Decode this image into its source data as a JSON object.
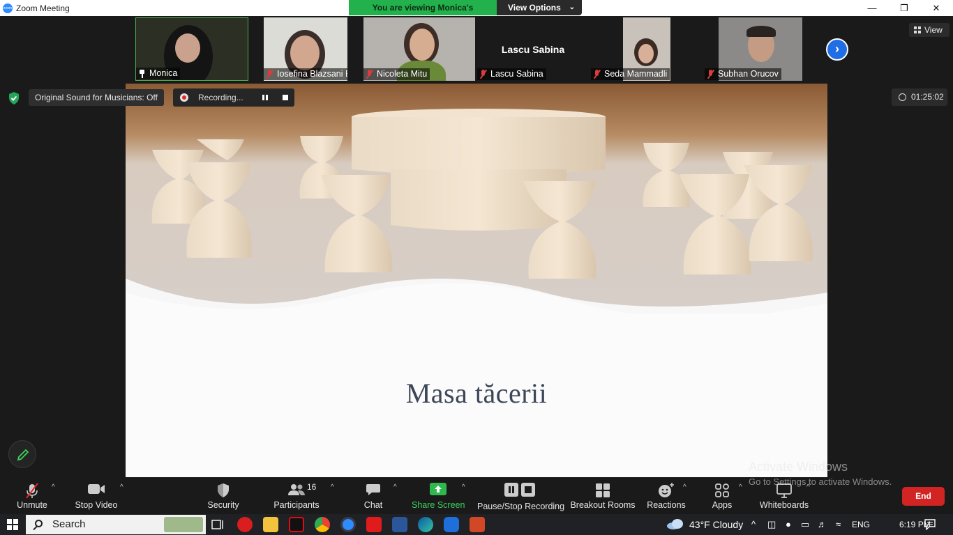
{
  "window": {
    "title": "Zoom Meeting"
  },
  "banner": {
    "viewing": "You are viewing Monica's screen",
    "view_options": "View Options"
  },
  "view_button": "View",
  "participants": [
    {
      "name": "Monica",
      "pinned": true
    },
    {
      "name": "Iosefina Blazsani Batto",
      "muted": true
    },
    {
      "name": "Nicoleta Mitu",
      "muted": true
    },
    {
      "name": "Lascu Sabina",
      "muted": true,
      "video_off": true,
      "display_name": "Lascu Sabina"
    },
    {
      "name": "Seda Mammadli",
      "muted": true
    },
    {
      "name": "Subhan Orucov",
      "muted": true
    }
  ],
  "status": {
    "original_sound": "Original Sound for Musicians: Off",
    "recording": "Recording...",
    "timer": "01:25:02"
  },
  "slide": {
    "title": "Masa tăcerii"
  },
  "toolbar": {
    "unmute": "Unmute",
    "stop_video": "Stop Video",
    "security": "Security",
    "participants": "Participants",
    "participants_count": "16",
    "chat": "Chat",
    "share_screen": "Share Screen",
    "pause_stop_recording": "Pause/Stop Recording",
    "breakout_rooms": "Breakout Rooms",
    "reactions": "Reactions",
    "apps": "Apps",
    "whiteboards": "Whiteboards",
    "end": "End"
  },
  "watermark": {
    "line1": "Activate Windows",
    "line2": "Go to Settings to activate Windows."
  },
  "taskbar": {
    "search": "Search",
    "weather": "43°F  Cloudy",
    "language": "ENG",
    "time": "6:19 PM"
  },
  "colors": {
    "accent": "#2d8cff",
    "share_green": "#22b14c",
    "end_red": "#d32424",
    "muted_red": "#d93c3c"
  }
}
